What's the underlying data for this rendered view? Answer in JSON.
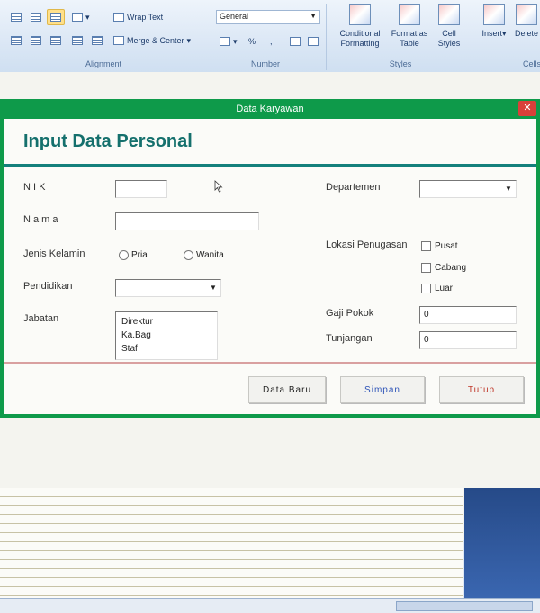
{
  "ribbon": {
    "alignment": {
      "wrap_text": "Wrap Text",
      "merge_center": "Merge & Center",
      "label": "Alignment"
    },
    "number": {
      "format_value": "General",
      "percent": "%",
      "label": "Number"
    },
    "styles": {
      "conditional_formatting": "Conditional Formatting",
      "format_as_table": "Format as Table",
      "cell_styles": "Cell Styles",
      "label": "Styles"
    },
    "cells": {
      "insert": "Insert",
      "delete": "Delete",
      "label": "Cells"
    }
  },
  "dialog": {
    "title": "Data Karyawan",
    "close": "✕",
    "heading": "Input Data Personal",
    "fields": {
      "nik_label": "N I K",
      "nama_label": "N a m a",
      "jenis_kelamin_label": "Jenis Kelamin",
      "gender_options": [
        "Pria",
        "Wanita"
      ],
      "pendidikan_label": "Pendidikan",
      "jabatan_label": "Jabatan",
      "jabatan_options": [
        "Direktur",
        "Ka.Bag",
        "Staf"
      ],
      "departemen_label": "Departemen",
      "lokasi_label": "Lokasi Penugasan",
      "lokasi_options": [
        "Pusat",
        "Cabang",
        "Luar"
      ],
      "gaji_pokok_label": "Gaji Pokok",
      "gaji_pokok_value": "0",
      "tunjangan_label": "Tunjangan",
      "tunjangan_value": "0"
    },
    "buttons": {
      "new": "Data Baru",
      "save": "Simpan",
      "close": "Tutup"
    },
    "colors": {
      "frame": "#0e9a4a",
      "heading": "#15706d",
      "save_text": "#2f55b8",
      "close_text": "#c0392b"
    }
  }
}
